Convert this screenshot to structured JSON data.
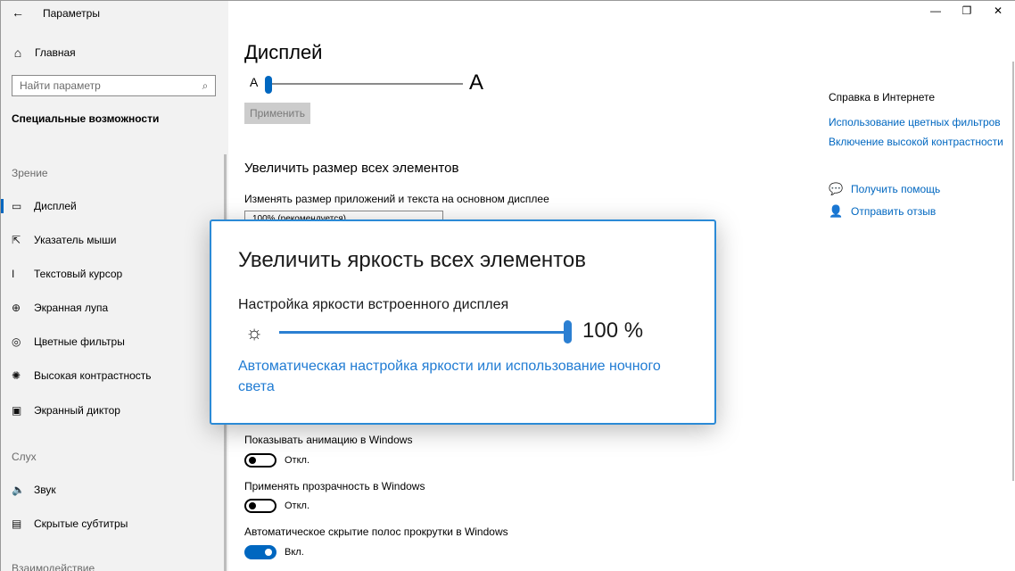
{
  "window": {
    "title": "Параметры",
    "minimize": "—",
    "restore": "❐",
    "close": "✕"
  },
  "sidebar": {
    "home_label": "Главная",
    "search_placeholder": "Найти параметр",
    "category_title": "Специальные возможности",
    "groups": [
      {
        "label": "Зрение",
        "items": [
          {
            "label": "Дисплей",
            "icon": "display-icon",
            "glyph": "▭",
            "active": true
          },
          {
            "label": "Указатель мыши",
            "icon": "mouse-pointer-icon",
            "glyph": "⇱"
          },
          {
            "label": "Текстовый курсор",
            "icon": "text-cursor-icon",
            "glyph": "I"
          },
          {
            "label": "Экранная лупа",
            "icon": "magnifier-icon",
            "glyph": "⊕"
          },
          {
            "label": "Цветные фильтры",
            "icon": "color-filter-icon",
            "glyph": "◎"
          },
          {
            "label": "Высокая контрастность",
            "icon": "high-contrast-icon",
            "glyph": "✺"
          },
          {
            "label": "Экранный диктор",
            "icon": "narrator-icon",
            "glyph": "▣"
          }
        ]
      },
      {
        "label": "Слух",
        "items": [
          {
            "label": "Звук",
            "icon": "sound-icon",
            "glyph": "🔈"
          },
          {
            "label": "Скрытые субтитры",
            "icon": "captions-icon",
            "glyph": "▤"
          }
        ]
      },
      {
        "label": "Взаимодействие",
        "items": []
      }
    ]
  },
  "main": {
    "page_title": "Дисплей",
    "size_slider": {
      "small_label": "A",
      "large_label": "A",
      "value_fraction": 0.0
    },
    "apply_label": "Применить",
    "section_title": "Увеличить размер всех элементов",
    "size_field_label": "Изменять размер приложений и текста на основном дисплее",
    "size_dropdown_value": "100% (рекомендуется)",
    "toggles": [
      {
        "label": "Показывать анимацию в Windows",
        "state": "Откл.",
        "on": false
      },
      {
        "label": "Применять прозрачность в Windows",
        "state": "Откл.",
        "on": false
      },
      {
        "label": "Автоматическое скрытие полос прокрутки в Windows",
        "state": "Вкл.",
        "on": true
      }
    ]
  },
  "help": {
    "title": "Справка в Интернете",
    "links": [
      "Использование цветных фильтров",
      "Включение высокой контрастности"
    ],
    "get_help": "Получить помощь",
    "feedback": "Отправить отзыв"
  },
  "popup": {
    "title": "Увеличить яркость всех элементов",
    "label": "Настройка яркости встроенного дисплея",
    "brightness_percent": 100,
    "brightness_text": "100 %",
    "link": "Автоматическая настройка яркости или использование ночного света"
  },
  "colors": {
    "accent": "#0067c0",
    "popup_border": "#2b8ad6",
    "link": "#1f7bd3"
  }
}
